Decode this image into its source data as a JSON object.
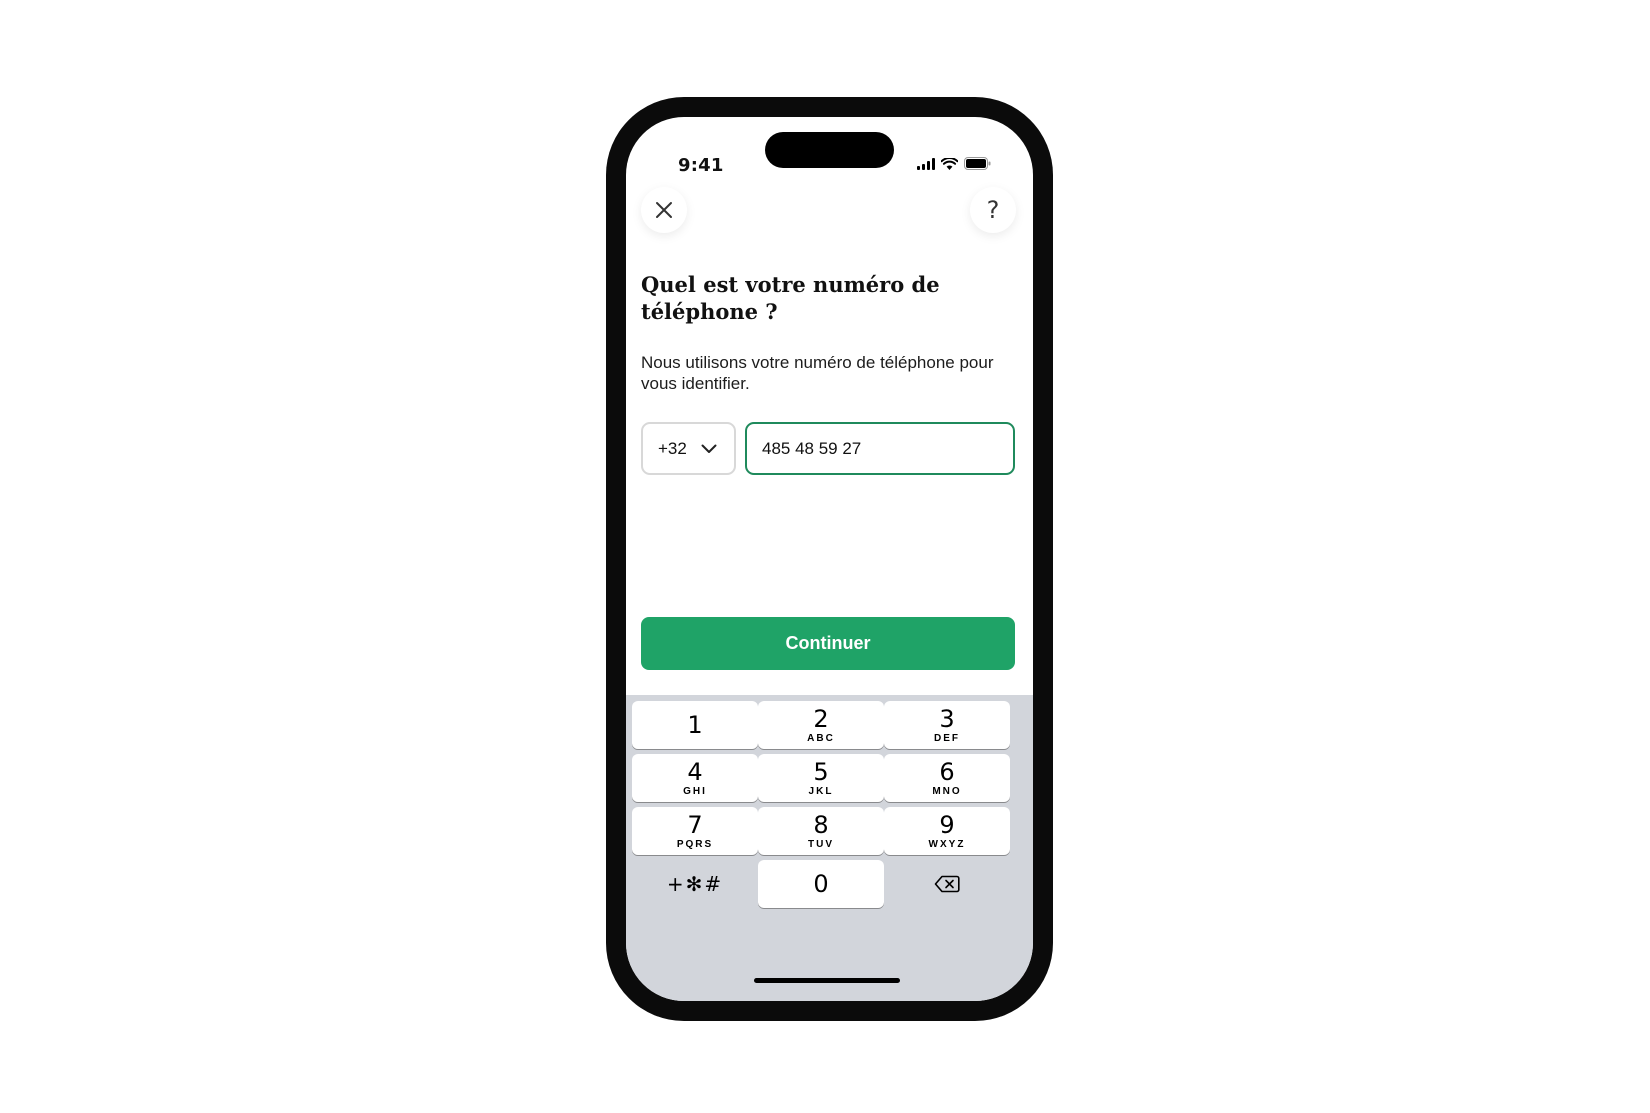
{
  "status_bar": {
    "time": "9:41"
  },
  "header": {
    "help_label": "?"
  },
  "title": "Quel est votre numéro de téléphone ?",
  "subtitle": "Nous utilisons votre numéro de téléphone pour vous identifier.",
  "country_code": {
    "value": "+32"
  },
  "phone_field": {
    "value": "485 48 59 27"
  },
  "continue_label": "Continuer",
  "keypad": {
    "keys": [
      {
        "digit": "1",
        "letters": ""
      },
      {
        "digit": "2",
        "letters": "ABC"
      },
      {
        "digit": "3",
        "letters": "DEF"
      },
      {
        "digit": "4",
        "letters": "GHI"
      },
      {
        "digit": "5",
        "letters": "JKL"
      },
      {
        "digit": "6",
        "letters": "MNO"
      },
      {
        "digit": "7",
        "letters": "PQRS"
      },
      {
        "digit": "8",
        "letters": "TUV"
      },
      {
        "digit": "9",
        "letters": "WXYZ"
      }
    ],
    "symbols_label": "+✻#",
    "zero": "0"
  },
  "colors": {
    "accent": "#1fa367",
    "input_border_focus": "#1f8a5c",
    "keyboard_bg": "#d2d5db"
  }
}
